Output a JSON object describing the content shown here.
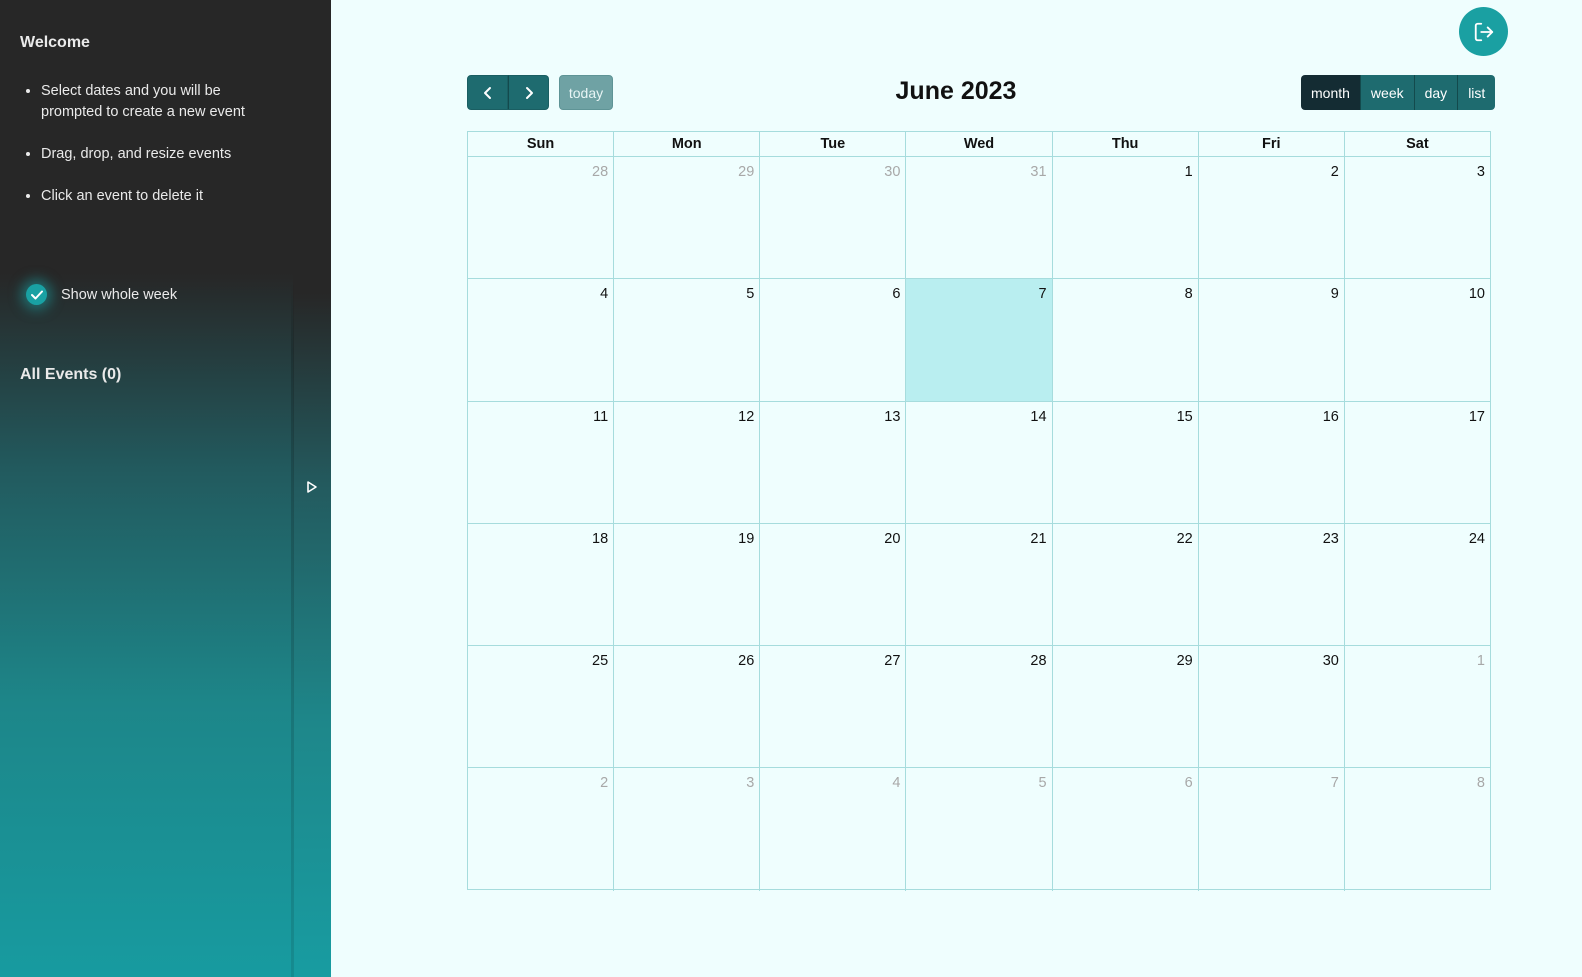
{
  "sidebar": {
    "welcome_title": "Welcome",
    "instructions": [
      "Select dates and you will be prompted to create a new event",
      "Drag, drop, and resize events",
      "Click an event to delete it"
    ],
    "toggle_label": "Show whole week",
    "toggle_checked": true,
    "events_title": "All Events (0)"
  },
  "toolbar": {
    "prev_icon": "chevron-left-icon",
    "next_icon": "chevron-right-icon",
    "today_label": "today",
    "title": "June 2023",
    "views": [
      "month",
      "week",
      "day",
      "list"
    ],
    "active_view": "month"
  },
  "logout_icon": "logout-icon",
  "calendar": {
    "weekdays": [
      "Sun",
      "Mon",
      "Tue",
      "Wed",
      "Thu",
      "Fri",
      "Sat"
    ],
    "today": 7,
    "weeks": [
      [
        {
          "d": "28",
          "o": true
        },
        {
          "d": "29",
          "o": true
        },
        {
          "d": "30",
          "o": true
        },
        {
          "d": "31",
          "o": true
        },
        {
          "d": "1",
          "o": false
        },
        {
          "d": "2",
          "o": false
        },
        {
          "d": "3",
          "o": false
        }
      ],
      [
        {
          "d": "4",
          "o": false
        },
        {
          "d": "5",
          "o": false
        },
        {
          "d": "6",
          "o": false
        },
        {
          "d": "7",
          "o": false
        },
        {
          "d": "8",
          "o": false
        },
        {
          "d": "9",
          "o": false
        },
        {
          "d": "10",
          "o": false
        }
      ],
      [
        {
          "d": "11",
          "o": false
        },
        {
          "d": "12",
          "o": false
        },
        {
          "d": "13",
          "o": false
        },
        {
          "d": "14",
          "o": false
        },
        {
          "d": "15",
          "o": false
        },
        {
          "d": "16",
          "o": false
        },
        {
          "d": "17",
          "o": false
        }
      ],
      [
        {
          "d": "18",
          "o": false
        },
        {
          "d": "19",
          "o": false
        },
        {
          "d": "20",
          "o": false
        },
        {
          "d": "21",
          "o": false
        },
        {
          "d": "22",
          "o": false
        },
        {
          "d": "23",
          "o": false
        },
        {
          "d": "24",
          "o": false
        }
      ],
      [
        {
          "d": "25",
          "o": false
        },
        {
          "d": "26",
          "o": false
        },
        {
          "d": "27",
          "o": false
        },
        {
          "d": "28",
          "o": false
        },
        {
          "d": "29",
          "o": false
        },
        {
          "d": "30",
          "o": false
        },
        {
          "d": "1",
          "o": true
        }
      ],
      [
        {
          "d": "2",
          "o": true
        },
        {
          "d": "3",
          "o": true
        },
        {
          "d": "4",
          "o": true
        },
        {
          "d": "5",
          "o": true
        },
        {
          "d": "6",
          "o": true
        },
        {
          "d": "7",
          "o": true
        },
        {
          "d": "8",
          "o": true
        }
      ]
    ]
  },
  "colors": {
    "accent": "#1aa0a2",
    "today_bg": "#b9eef0",
    "page_bg": "#effefe"
  }
}
